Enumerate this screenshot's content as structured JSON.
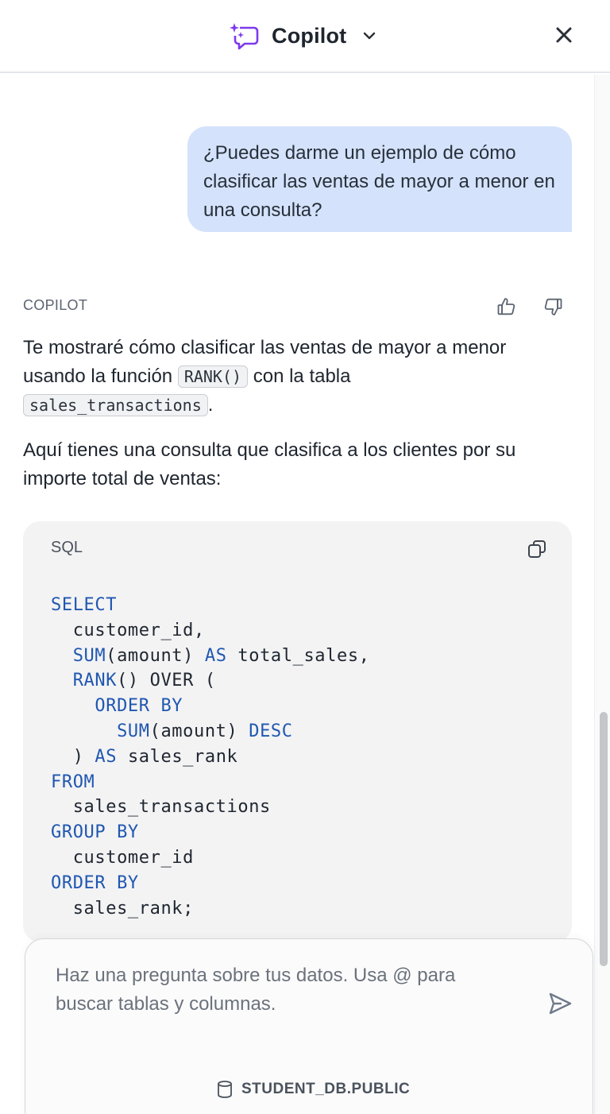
{
  "header": {
    "title": "Copilot",
    "icon": "copilot-chat-sparkle-icon",
    "accent_color": "#7c3aed"
  },
  "conversation": {
    "user_message": "¿Puedes darme un ejemplo de cómo clasificar las ventas de mayor a menor en una consulta?",
    "assistant_label": "COPILOT",
    "para1": {
      "before": "Te mostraré cómo clasificar las ventas de mayor a menor usando la función ",
      "code1": "RANK()",
      "middle": " con la tabla ",
      "code2": "sales_transactions",
      "after": "."
    },
    "para2": "Aquí tienes una consulta que clasifica a los clientes por su importe total de ventas:",
    "code_block": {
      "language": "SQL",
      "lines": [
        [
          {
            "t": "SELECT",
            "k": true
          }
        ],
        [
          {
            "t": "  customer_id,",
            "k": false
          }
        ],
        [
          {
            "t": "  SUM",
            "k": true
          },
          {
            "t": "(amount) ",
            "k": false
          },
          {
            "t": "AS",
            "k": true
          },
          {
            "t": " total_sales,",
            "k": false
          }
        ],
        [
          {
            "t": "  RANK",
            "k": true
          },
          {
            "t": "() OVER (",
            "k": false
          }
        ],
        [
          {
            "t": "    ORDER BY",
            "k": true
          }
        ],
        [
          {
            "t": "      SUM",
            "k": true
          },
          {
            "t": "(amount) ",
            "k": false
          },
          {
            "t": "DESC",
            "k": true
          }
        ],
        [
          {
            "t": "  ) ",
            "k": false
          },
          {
            "t": "AS",
            "k": true
          },
          {
            "t": " sales_rank",
            "k": false
          }
        ],
        [
          {
            "t": "FROM",
            "k": true
          }
        ],
        [
          {
            "t": "  sales_transactions",
            "k": false
          }
        ],
        [
          {
            "t": "GROUP BY",
            "k": true
          }
        ],
        [
          {
            "t": "  customer_id",
            "k": false
          }
        ],
        [
          {
            "t": "ORDER BY",
            "k": true
          }
        ],
        [
          {
            "t": "  sales_rank;",
            "k": false
          }
        ]
      ]
    }
  },
  "composer": {
    "placeholder": "Haz una pregunta sobre tus datos. Usa @ para buscar tablas y columnas.",
    "database": "STUDENT_DB.PUBLIC"
  }
}
